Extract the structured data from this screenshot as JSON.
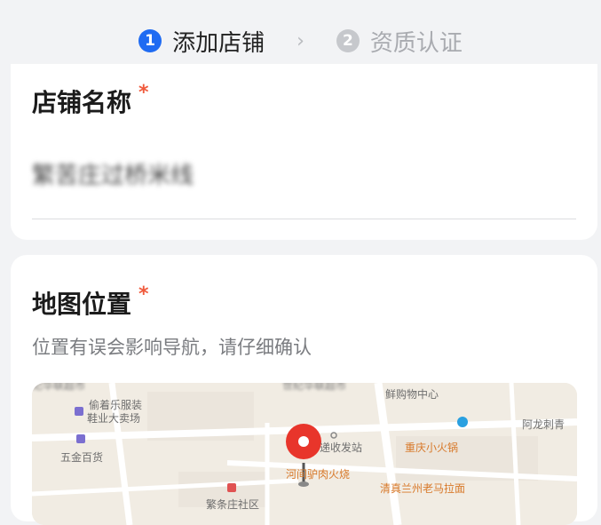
{
  "steps": [
    {
      "number": "1",
      "label": "添加店铺"
    },
    {
      "number": "2",
      "label": "资质认证"
    }
  ],
  "store_card": {
    "title": "店铺名称",
    "required_mark": "*",
    "value": "繁苦庄过桥米线"
  },
  "map_card": {
    "title": "地图位置",
    "required_mark": "*",
    "hint": "位置有误会影响导航，请仔细确认",
    "pois": [
      {
        "name": "世纪华联超市",
        "style": "blurry"
      },
      {
        "name": "世纪华联超市",
        "style": "blurry"
      },
      {
        "name": "鲜购物中心",
        "style": "gray"
      },
      {
        "name": "偷着乐服装",
        "style": "gray"
      },
      {
        "name": "鞋业大卖场",
        "style": "gray"
      },
      {
        "name": "阿龙刺青",
        "style": "gray"
      },
      {
        "name": "五金百货",
        "style": "gray"
      },
      {
        "name": "递收发站",
        "style": "gray"
      },
      {
        "name": "重庆小火锅",
        "style": "orange"
      },
      {
        "name": "河间驴肉火烧",
        "style": "orange"
      },
      {
        "name": "清真兰州老马拉面",
        "style": "orange"
      },
      {
        "name": "繁条庄社区",
        "style": "gray"
      }
    ]
  },
  "colors": {
    "accent": "#1f6bf2",
    "required": "#f05a3c",
    "pin": "#e8352b"
  }
}
